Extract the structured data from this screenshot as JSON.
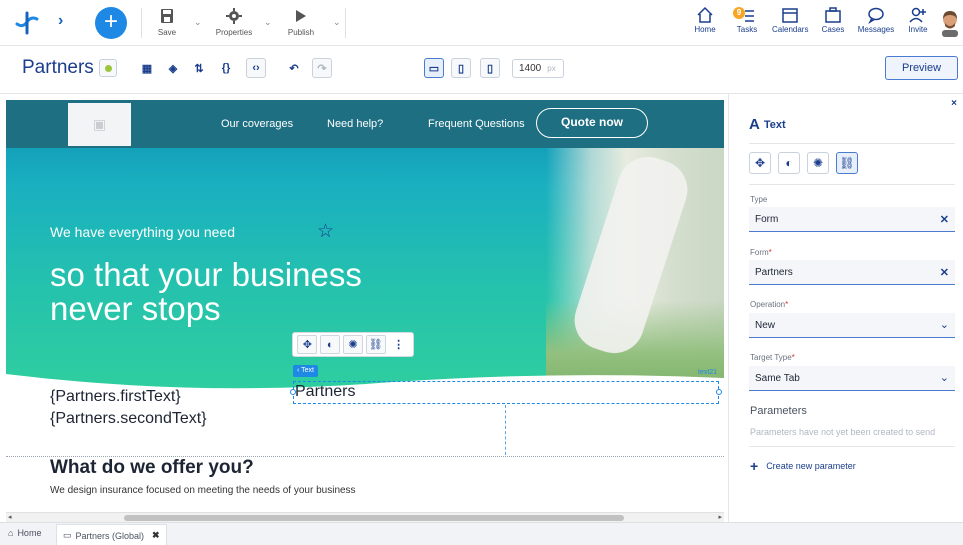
{
  "toolbar": {
    "save_label": "Save",
    "properties_label": "Properties",
    "publish_label": "Publish"
  },
  "nav": {
    "home": "Home",
    "tasks": "Tasks",
    "tasks_badge": "9",
    "calendars": "Calendars",
    "cases": "Cases",
    "messages": "Messages",
    "invite": "Invite"
  },
  "page": {
    "title": "Partners",
    "width_value": "1400",
    "width_unit": "px",
    "preview_label": "Preview"
  },
  "hero": {
    "nav_items": [
      "Our coverages",
      "Need help?",
      "Frequent Questions"
    ],
    "quote_button": "Quote now",
    "kicker": "We have everything you need",
    "headline": "so that your business never stops"
  },
  "editor": {
    "tag_label": "‹ Text",
    "element_id": "text21",
    "selected_text": "Partners",
    "text_line1": "{Partners.firstText}",
    "text_line2": "{Partners.secondText}"
  },
  "offer": {
    "title": "What do we offer you?",
    "subtitle": "We design insurance focused on meeting the needs of your business"
  },
  "panel": {
    "title": "Text",
    "close": "×",
    "type_label": "Type",
    "type_value": "Form",
    "form_label": "Form",
    "form_value": "Partners",
    "operation_label": "Operation",
    "operation_value": "New",
    "target_label": "Target Type",
    "target_value": "Same Tab",
    "params_title": "Parameters",
    "params_empty": "Parameters have not yet been created to send",
    "create_param": "Create new parameter"
  },
  "tabs": [
    {
      "label": "Home",
      "icon": "home-icon"
    },
    {
      "label": "Partners (Global)",
      "icon": "form-icon",
      "active": true
    }
  ],
  "colors": {
    "brand": "#1a3e8c",
    "accent": "#1e88e5",
    "hero_dark": "#1e6f82",
    "hero_teal": "#25c2ad"
  }
}
